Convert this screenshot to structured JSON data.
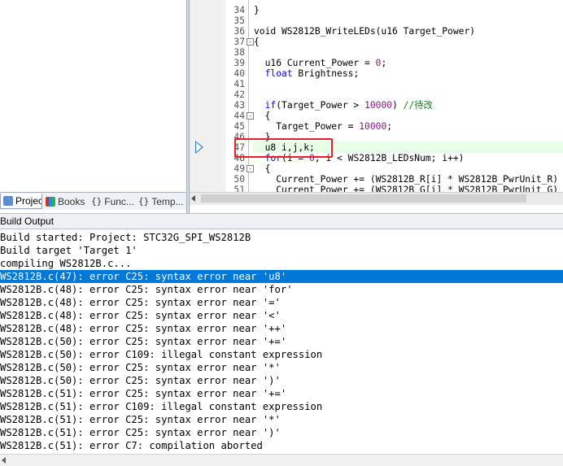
{
  "project_tabs": [
    {
      "label": "Project",
      "icon": "project-icon",
      "active": true
    },
    {
      "label": "Books",
      "icon": "books-icon",
      "active": false
    },
    {
      "label": "Func...",
      "icon": "functions-icon",
      "active": false
    },
    {
      "label": "Temp...",
      "icon": "templates-icon",
      "active": false
    }
  ],
  "editor": {
    "current_line": "47",
    "lines": [
      {
        "n": "34",
        "segments": [
          {
            "t": "}",
            "c": ""
          }
        ]
      },
      {
        "n": "35",
        "segments": []
      },
      {
        "n": "36",
        "segments": [
          {
            "t": "void WS2812B_WriteLEDs(u16 Target_Power)",
            "c": ""
          }
        ]
      },
      {
        "n": "37",
        "fold": "-",
        "segments": [
          {
            "t": "{",
            "c": ""
          }
        ]
      },
      {
        "n": "38",
        "segments": []
      },
      {
        "n": "39",
        "segments": [
          {
            "t": "  u16 Current_Power = ",
            "c": ""
          },
          {
            "t": "0",
            "c": "num"
          },
          {
            "t": ";",
            "c": ""
          }
        ]
      },
      {
        "n": "40",
        "segments": [
          {
            "t": "  ",
            "c": ""
          },
          {
            "t": "float",
            "c": "kw"
          },
          {
            "t": " Brightness;",
            "c": ""
          }
        ]
      },
      {
        "n": "41",
        "segments": []
      },
      {
        "n": "42",
        "segments": []
      },
      {
        "n": "43",
        "segments": [
          {
            "t": "  ",
            "c": ""
          },
          {
            "t": "if",
            "c": "kw"
          },
          {
            "t": "(Target_Power > ",
            "c": ""
          },
          {
            "t": "10000",
            "c": "num"
          },
          {
            "t": ") ",
            "c": ""
          },
          {
            "t": "//待改",
            "c": "cm"
          }
        ]
      },
      {
        "n": "44",
        "fold": "-",
        "segments": [
          {
            "t": "  {",
            "c": ""
          }
        ]
      },
      {
        "n": "45",
        "segments": [
          {
            "t": "    Target_Power = ",
            "c": ""
          },
          {
            "t": "10000",
            "c": "num"
          },
          {
            "t": ";",
            "c": ""
          }
        ]
      },
      {
        "n": "46",
        "segments": [
          {
            "t": "  }",
            "c": ""
          }
        ]
      },
      {
        "n": "47",
        "segments": [
          {
            "t": "  u8 i,j,k;",
            "c": ""
          }
        ]
      },
      {
        "n": "48",
        "segments": [
          {
            "t": "  ",
            "c": ""
          },
          {
            "t": "for",
            "c": "kw"
          },
          {
            "t": "(i = ",
            "c": ""
          },
          {
            "t": "0",
            "c": "num"
          },
          {
            "t": "; i < WS2812B_LEDsNum; i++)",
            "c": ""
          }
        ]
      },
      {
        "n": "49",
        "fold": "-",
        "segments": [
          {
            "t": "  {",
            "c": ""
          }
        ]
      },
      {
        "n": "50",
        "segments": [
          {
            "t": "    Current_Power += (WS2812B_R[i] * WS2812B_PwrUnit_R)",
            "c": ""
          }
        ]
      },
      {
        "n": "51",
        "segments": [
          {
            "t": "    Current_Power += (WS2812B_G[i] * WS2812B_PwrUnit_G)",
            "c": ""
          }
        ]
      }
    ]
  },
  "build_output": {
    "title": "Build Output",
    "selected_index": 3,
    "lines": [
      "Build started: Project: STC32G_SPI_WS2812B",
      "Build target 'Target 1'",
      "compiling WS2812B.c...",
      "WS2812B.c(47): error C25: syntax error near 'u8'",
      "WS2812B.c(48): error C25: syntax error near 'for'",
      "WS2812B.c(48): error C25: syntax error near '='",
      "WS2812B.c(48): error C25: syntax error near '<'",
      "WS2812B.c(48): error C25: syntax error near '++'",
      "WS2812B.c(50): error C25: syntax error near '+='",
      "WS2812B.c(50): error C109: illegal constant expression",
      "WS2812B.c(50): error C25: syntax error near '*'",
      "WS2812B.c(50): error C25: syntax error near ')'",
      "WS2812B.c(51): error C25: syntax error near '+='",
      "WS2812B.c(51): error C109: illegal constant expression",
      "WS2812B.c(51): error C25: syntax error near '*'",
      "WS2812B.c(51): error C25: syntax error near ')'",
      "WS2812B.c(51): error C7: compilation aborted"
    ]
  },
  "colors": {
    "selection": "#0078d7",
    "keyword": "#0000ff",
    "comment": "#1c7a1c",
    "number": "#7d1a7d",
    "highlight_box": "#e0202a"
  }
}
